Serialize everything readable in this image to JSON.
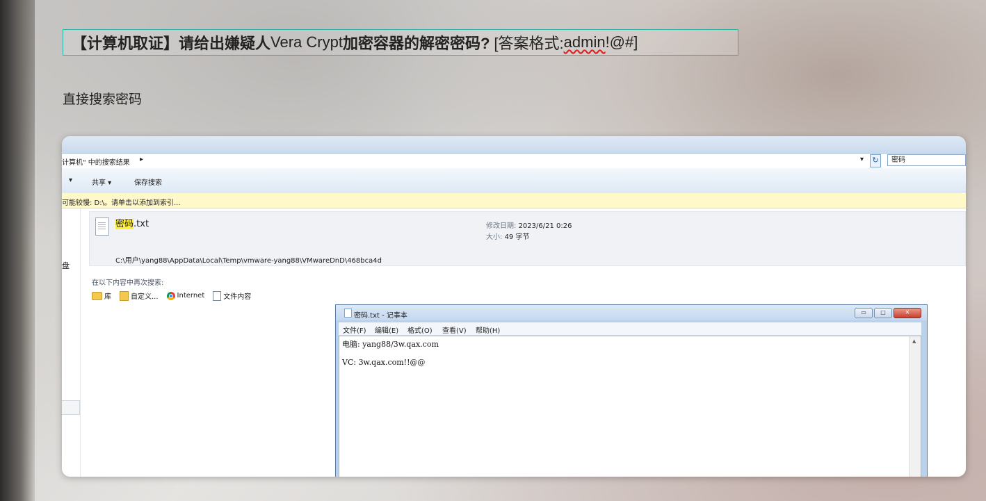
{
  "question": {
    "part1": "【计算机取证】请给出嫌疑人",
    "part2": "Vera Crypt",
    "part3": "加密容器的解密密码?",
    "part4": "[答案格式:",
    "answer_example": "admin",
    "part5": "!@#]"
  },
  "intro_text": "直接搜索密码",
  "explorer": {
    "address_text": "计算机\" 中的搜索结果",
    "address_arrow": "▸",
    "address_dropdown": "▾",
    "refresh_icon": "↻",
    "search_value": "密码",
    "toolbar": {
      "left_arrow": "▾",
      "share": "共享 ▾",
      "save_search": "保存搜索"
    },
    "infobar_text": "可能较慢: D:\\。请单击以添加到索引...",
    "nav_char": "盘",
    "result": {
      "name_highlight": "密码",
      "name_ext": ".txt",
      "modified_label": "修改日期:",
      "modified_value": "2023/6/21 0:26",
      "size_label": "大小:",
      "size_value": "49 字节",
      "path": "C:\\用户\\yang88\\AppData\\Local\\Temp\\vmware-yang88\\VMwareDnD\\468bca4d"
    },
    "search_again_label": "在以下内容中再次搜索:",
    "locations": [
      "库",
      "自定义...",
      "Internet",
      "文件内容"
    ]
  },
  "notepad": {
    "title": "密码.txt - 记事本",
    "menu": [
      "文件(F)",
      "编辑(E)",
      "格式(O)",
      "查看(V)",
      "帮助(H)"
    ],
    "lines": [
      "电脑: yang88/3w.qax.com",
      "VC: 3w.qax.com!!@@"
    ],
    "btn_min": "▭",
    "btn_max": "□",
    "btn_close": "✕"
  }
}
